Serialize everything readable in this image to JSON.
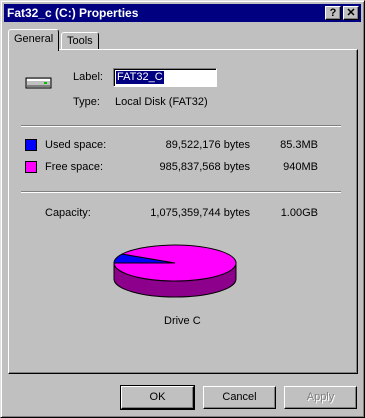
{
  "window": {
    "title": "Fat32_c (C:) Properties",
    "help_btn": "?",
    "close_btn": "✕"
  },
  "tabs": [
    {
      "label": "General",
      "active": true
    },
    {
      "label": "Tools",
      "active": false
    }
  ],
  "drive": {
    "icon": "hard-drive-icon",
    "label_caption": "Label:",
    "label_value": "FAT32_C",
    "type_caption": "Type:",
    "type_value": "Local Disk (FAT32)"
  },
  "space": {
    "used": {
      "caption": "Used space:",
      "bytes": "89,522,176 bytes",
      "size": "85.3MB",
      "color": "#0000ff"
    },
    "free": {
      "caption": "Free space:",
      "bytes": "985,837,568 bytes",
      "size": "940MB",
      "color": "#ff00ff"
    },
    "capacity": {
      "caption": "Capacity:",
      "bytes": "1,075,359,744 bytes",
      "size": "1.00GB"
    }
  },
  "chart_data": {
    "type": "pie",
    "categories": [
      "Used space",
      "Free space"
    ],
    "values": [
      89522176,
      985837568
    ],
    "colors": [
      "#0000ff",
      "#ff00ff"
    ]
  },
  "drive_caption": "Drive C",
  "buttons": {
    "ok": "OK",
    "cancel": "Cancel",
    "apply": "Apply"
  }
}
